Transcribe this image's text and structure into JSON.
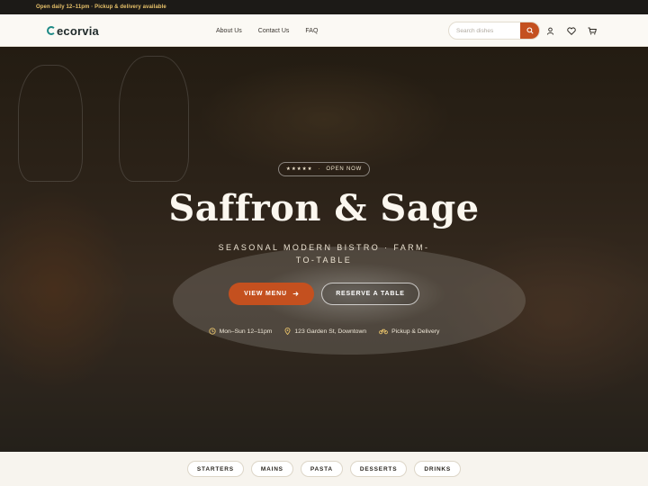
{
  "topbar": {
    "announcement": "Open daily 12–11pm · Pickup & delivery available"
  },
  "header": {
    "logo_text": "ecorvia",
    "nav": [
      "About Us",
      "Contact Us",
      "FAQ"
    ],
    "search_placeholder": "Search dishes",
    "icons": [
      "user-icon",
      "heart-icon",
      "cart-icon"
    ],
    "accent_color": "#c4501f"
  },
  "hero": {
    "badge_stars": "★★★★★",
    "badge_text": "OPEN NOW",
    "title": "Saffron & Sage",
    "subtitle": "SEASONAL MODERN BISTRO · FARM-TO-TABLE",
    "primary_button": "VIEW MENU",
    "secondary_button": "RESERVE A TABLE",
    "info": [
      {
        "icon": "clock-icon",
        "text": "Mon–Sun 12–11pm"
      },
      {
        "icon": "location-pin-icon",
        "text": "123 Garden St, Downtown"
      },
      {
        "icon": "bike-icon",
        "text": "Pickup & Delivery"
      }
    ]
  },
  "categories": [
    "STARTERS",
    "MAINS",
    "PASTA",
    "DESSERTS",
    "DRINKS"
  ]
}
